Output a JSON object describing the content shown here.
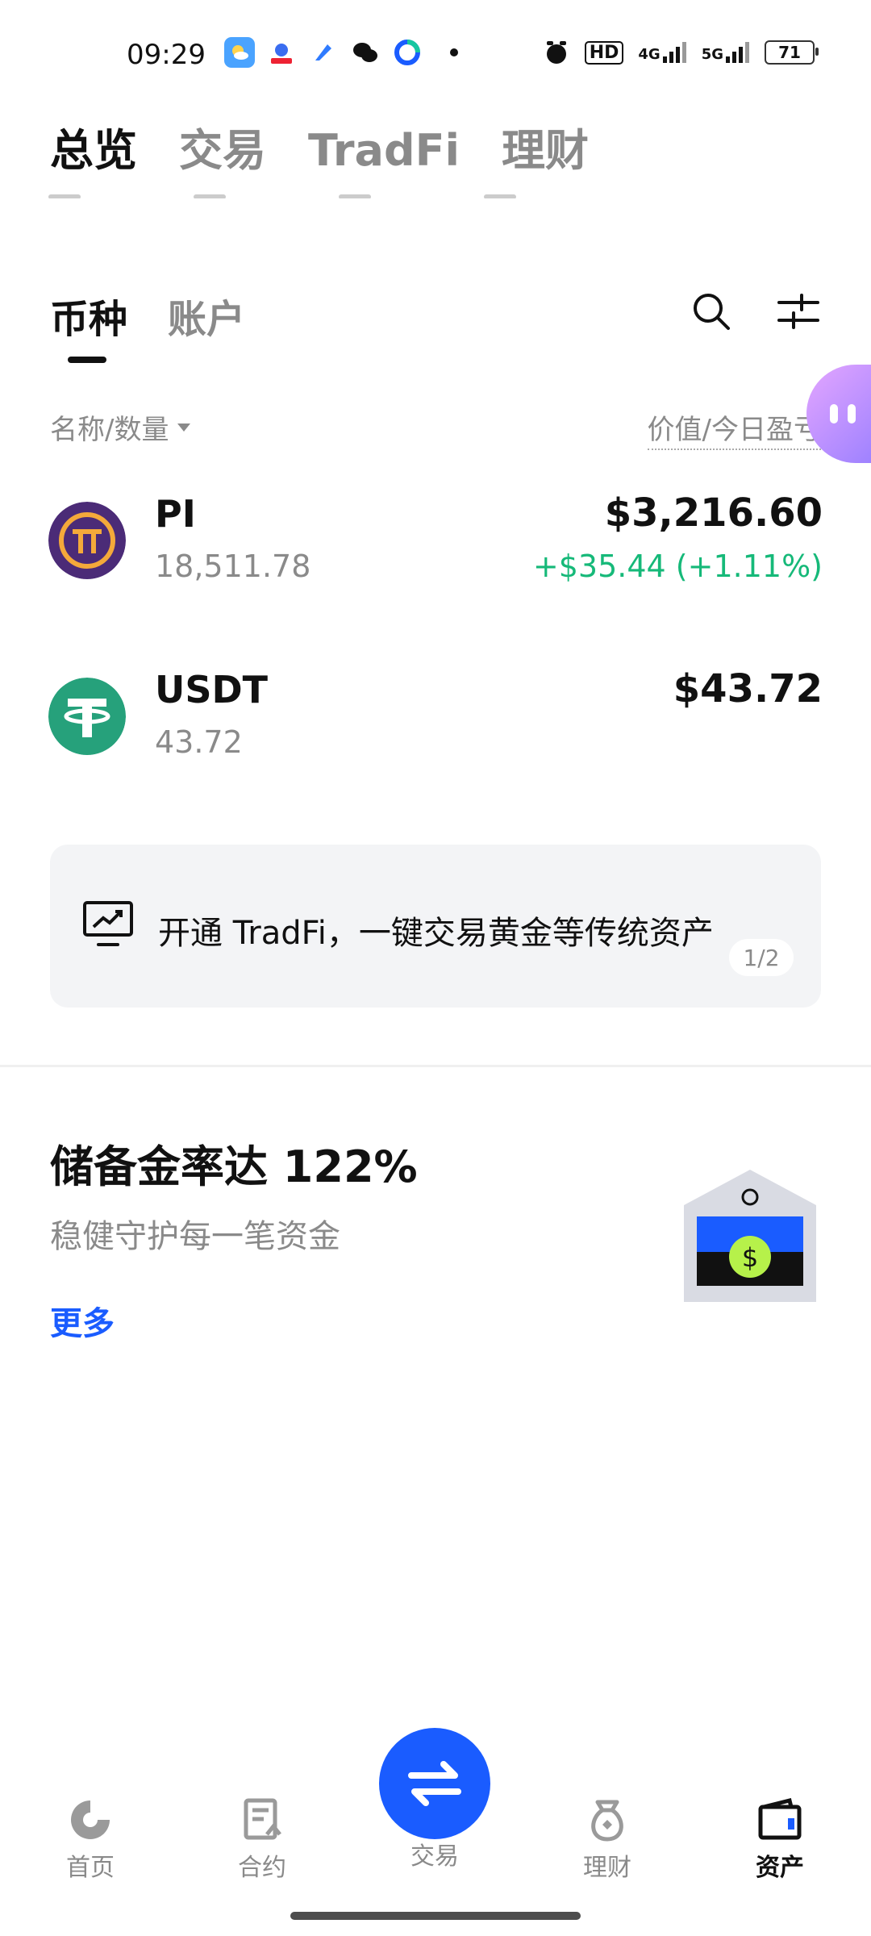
{
  "status_bar": {
    "time": "09:29",
    "network_hd": "HD",
    "net1": "4G",
    "net2": "5G",
    "battery": "71"
  },
  "top_tabs": [
    {
      "label": "总览",
      "active": true
    },
    {
      "label": "交易",
      "active": false
    },
    {
      "label": "TradFi",
      "active": false
    },
    {
      "label": "理财",
      "active": false
    }
  ],
  "sub_tabs": [
    {
      "label": "币种",
      "active": true
    },
    {
      "label": "账户",
      "active": false
    }
  ],
  "list_header": {
    "left": "名称/数量",
    "right": "价值/今日盈亏"
  },
  "assets": [
    {
      "symbol": "PI",
      "quantity": "18,511.78",
      "value": "$3,216.60",
      "pnl": "+$35.44 (+1.11%)"
    },
    {
      "symbol": "USDT",
      "quantity": "43.72",
      "value": "$43.72",
      "pnl": ""
    }
  ],
  "banner": {
    "text": "开通 TradFi，一键交易黄金等传统资产",
    "page": "1/2"
  },
  "reserve": {
    "title": "储备金率达 122%",
    "subtitle": "稳健守护每一笔资金",
    "more": "更多"
  },
  "bottom_nav": [
    {
      "label": "首页",
      "active": false
    },
    {
      "label": "合约",
      "active": false
    },
    {
      "label": "交易",
      "active": false
    },
    {
      "label": "理财",
      "active": false
    },
    {
      "label": "资产",
      "active": true
    }
  ],
  "colors": {
    "accent": "#1a5cff",
    "positive": "#16b979",
    "pi_brand": "#4b2b77",
    "usdt_brand": "#26a17b"
  }
}
